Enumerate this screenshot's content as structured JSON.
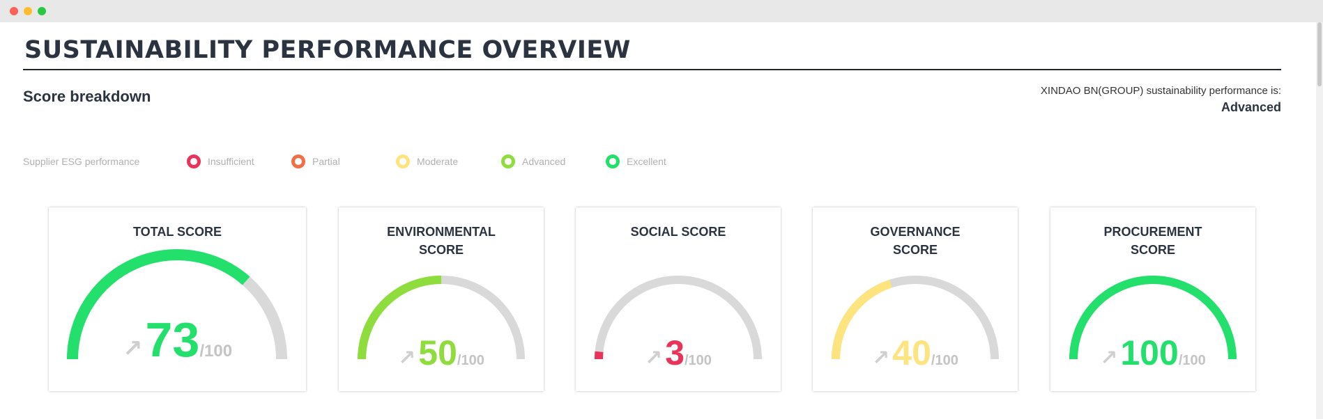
{
  "title": "SUSTAINABILITY PERFORMANCE OVERVIEW",
  "breakdown_title": "Score breakdown",
  "performance": {
    "label": "XINDAO BN(GROUP) sustainability performance is:",
    "value": "Advanced"
  },
  "legend": {
    "title": "Supplier ESG performance",
    "items": [
      {
        "label": "Insufficient",
        "color": "#e8345a"
      },
      {
        "label": "Partial",
        "color": "#ef6f47"
      },
      {
        "label": "Moderate",
        "color": "#fde47f"
      },
      {
        "label": "Advanced",
        "color": "#8fdd3c"
      },
      {
        "label": "Excellent",
        "color": "#22e06b"
      }
    ]
  },
  "colors": {
    "track": "#d9d9d9",
    "excellent": "#22e06b",
    "advanced": "#8fdd3c",
    "moderate": "#fde47f",
    "insufficient": "#e8345a"
  },
  "cards": [
    {
      "title": "TOTAL SCORE",
      "value": 73,
      "max_label": "/100",
      "arrow": "↗",
      "color": "#22e06b"
    },
    {
      "title": "ENVIRONMENTAL SCORE",
      "value": 50,
      "max_label": "/100",
      "arrow": "↗",
      "color": "#8fdd3c"
    },
    {
      "title": "SOCIAL SCORE",
      "value": 3,
      "max_label": "/100",
      "arrow": "↗",
      "color": "#e8345a"
    },
    {
      "title": "GOVERNANCE SCORE",
      "value": 40,
      "max_label": "/100",
      "arrow": "↗",
      "color": "#fde47f"
    },
    {
      "title": "PROCUREMENT SCORE",
      "value": 100,
      "max_label": "/100",
      "arrow": "↗",
      "color": "#22e06b"
    }
  ]
}
